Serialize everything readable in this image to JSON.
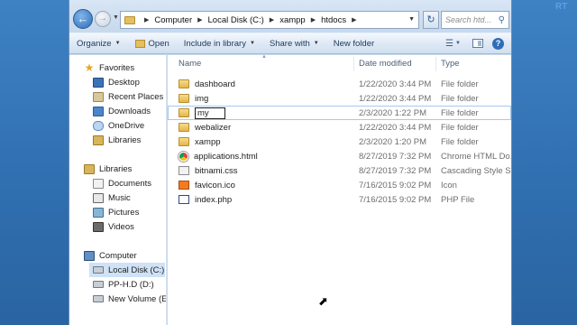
{
  "corner_logo": "RT",
  "address": {
    "crumbs": [
      "Computer",
      "Local Disk (C:)",
      "xampp",
      "htdocs"
    ]
  },
  "search": {
    "placeholder": "Search htd..."
  },
  "toolbar": {
    "organize": "Organize",
    "open": "Open",
    "include": "Include in library",
    "share": "Share with",
    "new_folder": "New folder"
  },
  "nav": {
    "favorites": "Favorites",
    "desktop": "Desktop",
    "recent": "Recent Places",
    "downloads": "Downloads",
    "onedrive": "OneDrive",
    "libraries_fav": "Libraries",
    "libraries": "Libraries",
    "documents": "Documents",
    "music": "Music",
    "pictures": "Pictures",
    "videos": "Videos",
    "computer": "Computer",
    "local_disk": "Local Disk (C:)",
    "pp_hd": "PP-H.D (D:)",
    "new_volume": "New Volume (E:)"
  },
  "columns": {
    "name": "Name",
    "date": "Date modified",
    "type": "Type"
  },
  "files": [
    {
      "name": "dashboard",
      "date": "1/22/2020 3:44 PM",
      "type": "File folder",
      "icon": "folder"
    },
    {
      "name": "img",
      "date": "1/22/2020 3:44 PM",
      "type": "File folder",
      "icon": "folder"
    },
    {
      "name": "my",
      "date": "2/3/2020 1:22 PM",
      "type": "File folder",
      "icon": "folder",
      "editing": true
    },
    {
      "name": "webalizer",
      "date": "1/22/2020 3:44 PM",
      "type": "File folder",
      "icon": "folder"
    },
    {
      "name": "xampp",
      "date": "2/3/2020 1:20 PM",
      "type": "File folder",
      "icon": "folder"
    },
    {
      "name": "applications.html",
      "date": "8/27/2019 7:32 PM",
      "type": "Chrome HTML Do...",
      "icon": "chrome-html"
    },
    {
      "name": "bitnami.css",
      "date": "8/27/2019 7:32 PM",
      "type": "Cascading Style S...",
      "icon": "css-file"
    },
    {
      "name": "favicon.ico",
      "date": "7/16/2015 9:02 PM",
      "type": "Icon",
      "icon": "ico-file"
    },
    {
      "name": "index.php",
      "date": "7/16/2015 9:02 PM",
      "type": "PHP File",
      "icon": "php-file"
    }
  ]
}
